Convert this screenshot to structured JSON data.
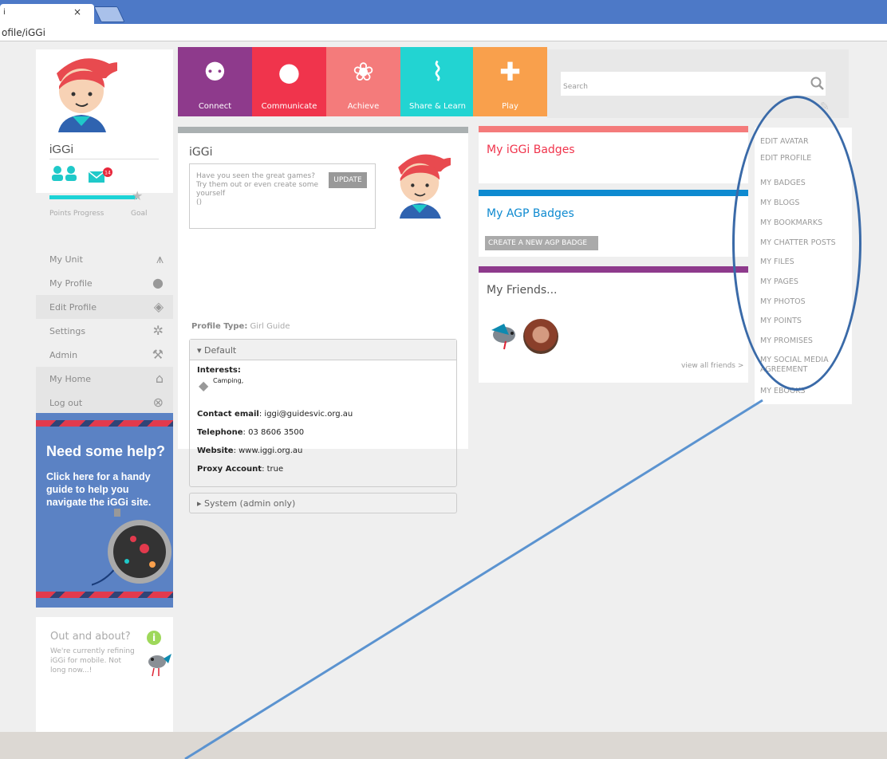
{
  "browser": {
    "tab_title": "i",
    "tab_close": "×",
    "address": "ofile/iGGi"
  },
  "left": {
    "username": "iGGi",
    "notification_count": "14",
    "progress_label": "Points Progress",
    "goal_label": "Goal",
    "progress_fraction": 0.82,
    "menu": [
      {
        "label": "My Unit",
        "icon": "person-icon"
      },
      {
        "label": "My Profile",
        "icon": "profile-icon"
      },
      {
        "label": "Edit Profile",
        "icon": "eraser-icon"
      },
      {
        "label": "Settings",
        "icon": "gear-icon"
      },
      {
        "label": "Admin",
        "icon": "wrench-icon"
      },
      {
        "label": "My Home",
        "icon": "home-icon"
      },
      {
        "label": "Log out",
        "icon": "close-circle-icon"
      }
    ],
    "help": {
      "title": "Need some help?",
      "body": "Click here for a handy guide to help you navigate the iGGi site."
    },
    "out": {
      "title": "Out and about?",
      "body": "We're currently refining iGGi for mobile. Not long now...!",
      "info": "i"
    }
  },
  "nav": [
    {
      "label": "Connect",
      "color": "#8e3a8c",
      "icon": "people-icon"
    },
    {
      "label": "Communicate",
      "color": "#f0344c",
      "icon": "speech-bubble-icon"
    },
    {
      "label": "Achieve",
      "color": "#f47b7b",
      "icon": "ribbon-icon"
    },
    {
      "label": "Share & Learn",
      "color": "#22d4d2",
      "icon": "paperclip-icon"
    },
    {
      "label": "Play",
      "color": "#f9a04c",
      "icon": "puzzle-icon"
    }
  ],
  "search": {
    "placeholder": "Search"
  },
  "profile": {
    "name": "iGGi",
    "status_text": "Have you seen the great games? Try them out or even create some yourself",
    "status_extra": "()",
    "update_label": "UPDATE",
    "type_label": "Profile Type:",
    "type_value": "Girl Guide",
    "default_header": "▾ Default",
    "interests_label": "Interests",
    "interests_value": "Camping,",
    "email_label": "Contact email",
    "email_value": "iggi@guidesvic.org.au",
    "phone_label": "Telephone",
    "phone_value": "03 8606 3500",
    "website_label": "Website",
    "website_value": "www.iggi.org.au",
    "proxy_label": "Proxy Account",
    "proxy_value": "true",
    "system_header": "▸ System (admin only)"
  },
  "widgets": {
    "iggi_badges": "My iGGi Badges",
    "agp_badges": "My AGP Badges",
    "create_agp": "CREATE A NEW AGP BADGE",
    "friends": "My Friends...",
    "view_all": "view all friends >"
  },
  "side_links": [
    "EDIT AVATAR",
    "EDIT PROFILE",
    "MY BADGES",
    "MY BLOGS",
    "MY BOOKMARKS",
    "MY CHATTER POSTS",
    "MY FILES",
    "MY PAGES",
    "MY PHOTOS",
    "MY POINTS",
    "MY PROMISES",
    "MY SOCIAL MEDIA AGREEMENT",
    "MY EBOOKS"
  ]
}
